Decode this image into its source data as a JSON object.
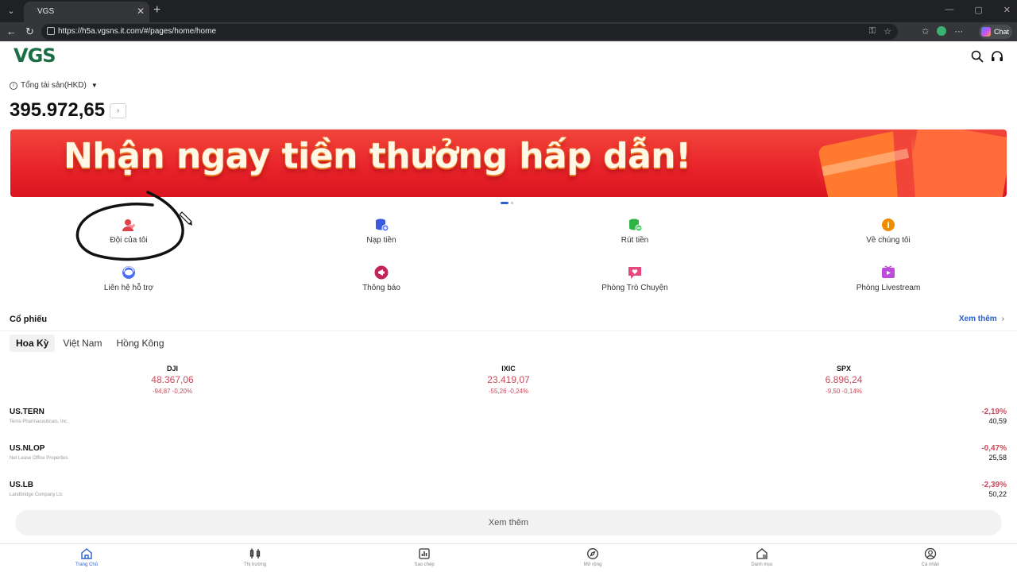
{
  "browser": {
    "tab_title": "VGS",
    "tab_close": "✕",
    "new_tab": "+",
    "url": "https://h5a.vgsns.it.com/#/pages/home/home",
    "chat_label": "Chat"
  },
  "header": {
    "logo": "VGS",
    "search_icon": "search-icon",
    "support_icon": "headset-icon"
  },
  "asset": {
    "label": "Tổng tài sản(HKD)",
    "value": "395.972,65",
    "arrow": "›"
  },
  "banner": {
    "text": "Nhận ngay tiền thưởng hấp dẫn!",
    "bg_color": "#e8222a"
  },
  "quick_actions": [
    {
      "label": "Đội của tôi",
      "icon": "team-icon",
      "color": "#e0404a"
    },
    {
      "label": "Nạp tiền",
      "icon": "deposit-icon",
      "color": "#3b5bdb"
    },
    {
      "label": "Rút tiền",
      "icon": "withdraw-icon",
      "color": "#2fb344"
    },
    {
      "label": "Về chúng tôi",
      "icon": "about-icon",
      "color": "#f08c00"
    },
    {
      "label": "Liên hệ hỗ trợ",
      "icon": "support-icon",
      "color": "#4c6ef5"
    },
    {
      "label": "Thông báo",
      "icon": "megaphone-icon",
      "color": "#c2255c"
    },
    {
      "label": "Phòng Trò Chuyện",
      "icon": "chat-room-icon",
      "color": "#e64980"
    },
    {
      "label": "Phòng Livestream",
      "icon": "livestream-icon",
      "color": "#be4bdb"
    }
  ],
  "stocks": {
    "title": "Cổ phiếu",
    "see_more": "Xem thêm",
    "tabs": [
      "Hoa Kỳ",
      "Việt Nam",
      "Hồng Kông"
    ],
    "indices": [
      {
        "name": "DJI",
        "value": "48.367,06",
        "change": "-94,87 -0,20%"
      },
      {
        "name": "IXIC",
        "value": "23.419,07",
        "change": "-55,26 -0,24%"
      },
      {
        "name": "SPX",
        "value": "6.896,24",
        "change": "-9,50 -0,14%"
      }
    ],
    "rows": [
      {
        "symbol": "US.TERN",
        "company": "Terns Pharmaceuticals, Inc.",
        "pct": "-2,19%",
        "price": "40,59"
      },
      {
        "symbol": "US.NLOP",
        "company": "Net Lease Office Properties",
        "pct": "-0,47%",
        "price": "25,58"
      },
      {
        "symbol": "US.LB",
        "company": "Landbridge Company Llc",
        "pct": "-2,39%",
        "price": "50,22"
      }
    ],
    "more_button": "Xem thêm",
    "down_color": "#c94a5c"
  },
  "bottom_nav": [
    {
      "label": "Trang Chủ",
      "icon": "home-icon"
    },
    {
      "label": "Thị trường",
      "icon": "market-icon"
    },
    {
      "label": "Sao chép",
      "icon": "copy-trade-icon"
    },
    {
      "label": "Mở rộng",
      "icon": "compass-icon"
    },
    {
      "label": "Danh mục",
      "icon": "portfolio-icon"
    },
    {
      "label": "Cá nhân",
      "icon": "profile-icon"
    }
  ]
}
